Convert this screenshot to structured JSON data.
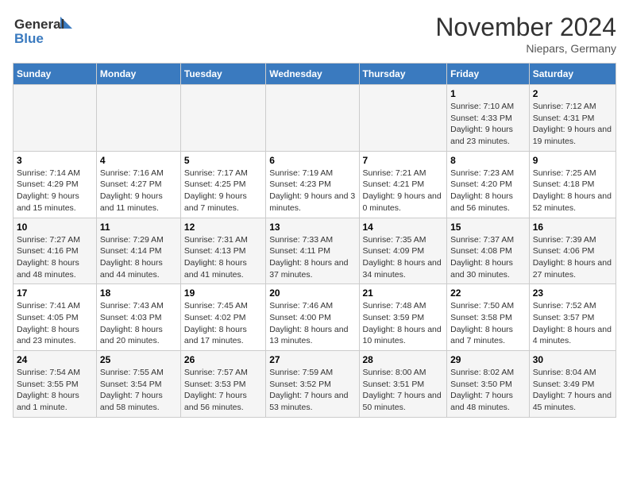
{
  "header": {
    "logo_general": "General",
    "logo_blue": "Blue",
    "month_title": "November 2024",
    "location": "Niepars, Germany"
  },
  "weekdays": [
    "Sunday",
    "Monday",
    "Tuesday",
    "Wednesday",
    "Thursday",
    "Friday",
    "Saturday"
  ],
  "weeks": [
    [
      {
        "day": "",
        "info": ""
      },
      {
        "day": "",
        "info": ""
      },
      {
        "day": "",
        "info": ""
      },
      {
        "day": "",
        "info": ""
      },
      {
        "day": "",
        "info": ""
      },
      {
        "day": "1",
        "info": "Sunrise: 7:10 AM\nSunset: 4:33 PM\nDaylight: 9 hours and 23 minutes."
      },
      {
        "day": "2",
        "info": "Sunrise: 7:12 AM\nSunset: 4:31 PM\nDaylight: 9 hours and 19 minutes."
      }
    ],
    [
      {
        "day": "3",
        "info": "Sunrise: 7:14 AM\nSunset: 4:29 PM\nDaylight: 9 hours and 15 minutes."
      },
      {
        "day": "4",
        "info": "Sunrise: 7:16 AM\nSunset: 4:27 PM\nDaylight: 9 hours and 11 minutes."
      },
      {
        "day": "5",
        "info": "Sunrise: 7:17 AM\nSunset: 4:25 PM\nDaylight: 9 hours and 7 minutes."
      },
      {
        "day": "6",
        "info": "Sunrise: 7:19 AM\nSunset: 4:23 PM\nDaylight: 9 hours and 3 minutes."
      },
      {
        "day": "7",
        "info": "Sunrise: 7:21 AM\nSunset: 4:21 PM\nDaylight: 9 hours and 0 minutes."
      },
      {
        "day": "8",
        "info": "Sunrise: 7:23 AM\nSunset: 4:20 PM\nDaylight: 8 hours and 56 minutes."
      },
      {
        "day": "9",
        "info": "Sunrise: 7:25 AM\nSunset: 4:18 PM\nDaylight: 8 hours and 52 minutes."
      }
    ],
    [
      {
        "day": "10",
        "info": "Sunrise: 7:27 AM\nSunset: 4:16 PM\nDaylight: 8 hours and 48 minutes."
      },
      {
        "day": "11",
        "info": "Sunrise: 7:29 AM\nSunset: 4:14 PM\nDaylight: 8 hours and 44 minutes."
      },
      {
        "day": "12",
        "info": "Sunrise: 7:31 AM\nSunset: 4:13 PM\nDaylight: 8 hours and 41 minutes."
      },
      {
        "day": "13",
        "info": "Sunrise: 7:33 AM\nSunset: 4:11 PM\nDaylight: 8 hours and 37 minutes."
      },
      {
        "day": "14",
        "info": "Sunrise: 7:35 AM\nSunset: 4:09 PM\nDaylight: 8 hours and 34 minutes."
      },
      {
        "day": "15",
        "info": "Sunrise: 7:37 AM\nSunset: 4:08 PM\nDaylight: 8 hours and 30 minutes."
      },
      {
        "day": "16",
        "info": "Sunrise: 7:39 AM\nSunset: 4:06 PM\nDaylight: 8 hours and 27 minutes."
      }
    ],
    [
      {
        "day": "17",
        "info": "Sunrise: 7:41 AM\nSunset: 4:05 PM\nDaylight: 8 hours and 23 minutes."
      },
      {
        "day": "18",
        "info": "Sunrise: 7:43 AM\nSunset: 4:03 PM\nDaylight: 8 hours and 20 minutes."
      },
      {
        "day": "19",
        "info": "Sunrise: 7:45 AM\nSunset: 4:02 PM\nDaylight: 8 hours and 17 minutes."
      },
      {
        "day": "20",
        "info": "Sunrise: 7:46 AM\nSunset: 4:00 PM\nDaylight: 8 hours and 13 minutes."
      },
      {
        "day": "21",
        "info": "Sunrise: 7:48 AM\nSunset: 3:59 PM\nDaylight: 8 hours and 10 minutes."
      },
      {
        "day": "22",
        "info": "Sunrise: 7:50 AM\nSunset: 3:58 PM\nDaylight: 8 hours and 7 minutes."
      },
      {
        "day": "23",
        "info": "Sunrise: 7:52 AM\nSunset: 3:57 PM\nDaylight: 8 hours and 4 minutes."
      }
    ],
    [
      {
        "day": "24",
        "info": "Sunrise: 7:54 AM\nSunset: 3:55 PM\nDaylight: 8 hours and 1 minute."
      },
      {
        "day": "25",
        "info": "Sunrise: 7:55 AM\nSunset: 3:54 PM\nDaylight: 7 hours and 58 minutes."
      },
      {
        "day": "26",
        "info": "Sunrise: 7:57 AM\nSunset: 3:53 PM\nDaylight: 7 hours and 56 minutes."
      },
      {
        "day": "27",
        "info": "Sunrise: 7:59 AM\nSunset: 3:52 PM\nDaylight: 7 hours and 53 minutes."
      },
      {
        "day": "28",
        "info": "Sunrise: 8:00 AM\nSunset: 3:51 PM\nDaylight: 7 hours and 50 minutes."
      },
      {
        "day": "29",
        "info": "Sunrise: 8:02 AM\nSunset: 3:50 PM\nDaylight: 7 hours and 48 minutes."
      },
      {
        "day": "30",
        "info": "Sunrise: 8:04 AM\nSunset: 3:49 PM\nDaylight: 7 hours and 45 minutes."
      }
    ]
  ]
}
